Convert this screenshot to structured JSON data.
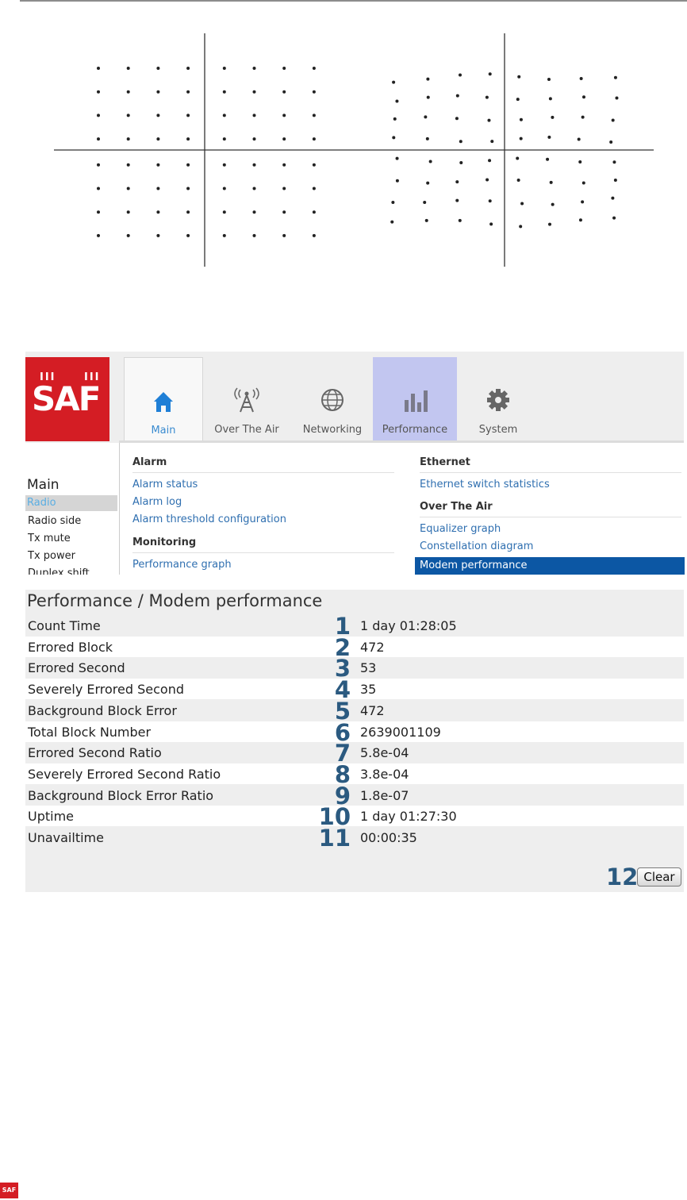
{
  "logo": {
    "bars": "III III",
    "word": "SAF"
  },
  "tabs": [
    {
      "label": "Main",
      "icon": "home-icon"
    },
    {
      "label": "Over The Air",
      "icon": "antenna-icon"
    },
    {
      "label": "Networking",
      "icon": "globe-icon"
    },
    {
      "label": "Performance",
      "icon": "bar-chart-icon"
    },
    {
      "label": "System",
      "icon": "gear-icon"
    }
  ],
  "sidebar": {
    "title": "Main",
    "items": [
      "Radio",
      "Radio side",
      "Tx mute",
      "Tx power",
      "Duplex shift"
    ]
  },
  "menu": {
    "left": {
      "heading1": "Alarm",
      "links1": [
        "Alarm status",
        "Alarm log",
        "Alarm threshold configuration"
      ],
      "heading2": "Monitoring",
      "links2": [
        "Performance graph"
      ]
    },
    "right": {
      "heading1": "Ethernet",
      "links1": [
        "Ethernet switch statistics"
      ],
      "heading2": "Over The Air",
      "links2": [
        "Equalizer graph",
        "Constellation diagram",
        "Modem performance"
      ]
    }
  },
  "panel": {
    "title": "Performance / Modem performance",
    "rows": [
      {
        "label": "Count Time",
        "num": "1",
        "value": "1 day 01:28:05"
      },
      {
        "label": "Errored Block",
        "num": "2",
        "value": "472"
      },
      {
        "label": "Errored Second",
        "num": "3",
        "value": "53"
      },
      {
        "label": "Severely Errored Second",
        "num": "4",
        "value": "35"
      },
      {
        "label": "Background Block Error",
        "num": "5",
        "value": "472"
      },
      {
        "label": "Total Block Number",
        "num": "6",
        "value": "2639001109"
      },
      {
        "label": "Errored Second Ratio",
        "num": "7",
        "value": "5.8e-04"
      },
      {
        "label": "Severely Errored Second Ratio",
        "num": "8",
        "value": "3.8e-04"
      },
      {
        "label": "Background Block Error Ratio",
        "num": "9",
        "value": "1.8e-07"
      },
      {
        "label": "Uptime",
        "num": "10",
        "value": "1 day 01:27:30"
      },
      {
        "label": "Unavailtime",
        "num": "11",
        "value": "00:00:35"
      }
    ],
    "clear_num": "12",
    "clear_label": "Clear"
  },
  "footer": {
    "logo": "SAF"
  },
  "colors": {
    "brand": "#d41d24",
    "accent": "#0c57a4",
    "link": "#2f6fb0",
    "callout": "#2b5a80"
  }
}
